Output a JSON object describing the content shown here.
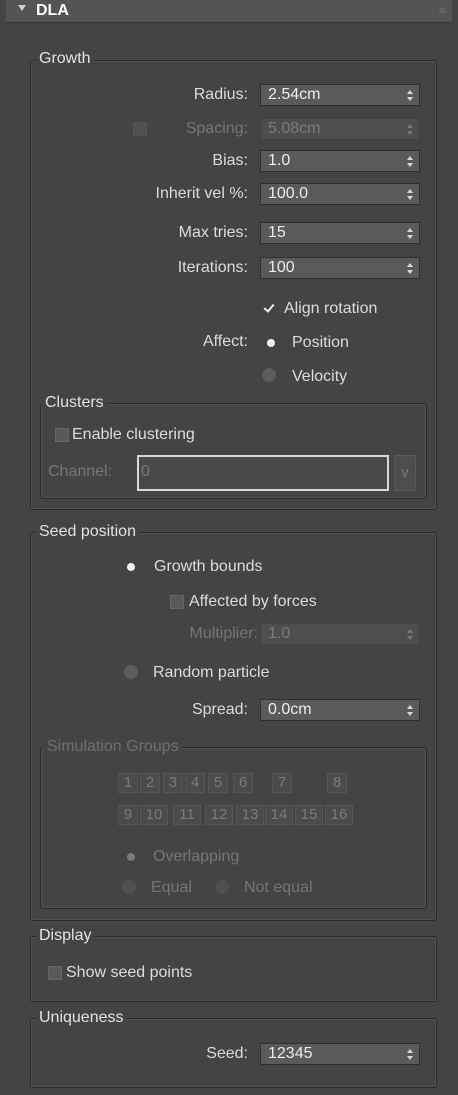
{
  "header": {
    "title": "DLA"
  },
  "growth": {
    "title": "Growth",
    "radius": {
      "label": "Radius:",
      "value": "2.54cm"
    },
    "spacing": {
      "label": "Spacing:",
      "value": "5.08cm"
    },
    "bias": {
      "label": "Bias:",
      "value": "1.0"
    },
    "inherit_vel": {
      "label": "Inherit vel %:",
      "value": "100.0"
    },
    "max_tries": {
      "label": "Max tries:",
      "value": "15"
    },
    "iterations": {
      "label": "Iterations:",
      "value": "100"
    },
    "align_rotation": {
      "label": "Align rotation",
      "checked": true
    },
    "affect": {
      "label": "Affect:",
      "options": [
        "Position",
        "Velocity"
      ],
      "selected": "Position"
    }
  },
  "clusters": {
    "title": "Clusters",
    "enable_clustering": {
      "label": "Enable clustering",
      "checked": false
    },
    "channel": {
      "label": "Channel:",
      "value": "0",
      "button": "v"
    }
  },
  "seed_position": {
    "title": "Seed position",
    "growth_bounds": "Growth bounds",
    "affected_by_forces": "Affected by forces",
    "multiplier": {
      "label": "Multiplier:",
      "value": "1.0"
    },
    "random_particle": "Random particle",
    "spread": {
      "label": "Spread:",
      "value": "0.0cm"
    },
    "selected": "Growth bounds"
  },
  "simulation_groups": {
    "title": "Simulation Groups",
    "buttons": [
      "1",
      "2",
      "3",
      "4",
      "5",
      "6",
      "7",
      "8",
      "9",
      "10",
      "11",
      "12",
      "13",
      "14",
      "15",
      "16"
    ],
    "overlapping": "Overlapping",
    "equal": "Equal",
    "not_equal": "Not equal"
  },
  "display": {
    "title": "Display",
    "show_seed_points": "Show seed points"
  },
  "uniqueness": {
    "title": "Uniqueness",
    "seed": {
      "label": "Seed:",
      "value": "12345"
    }
  }
}
